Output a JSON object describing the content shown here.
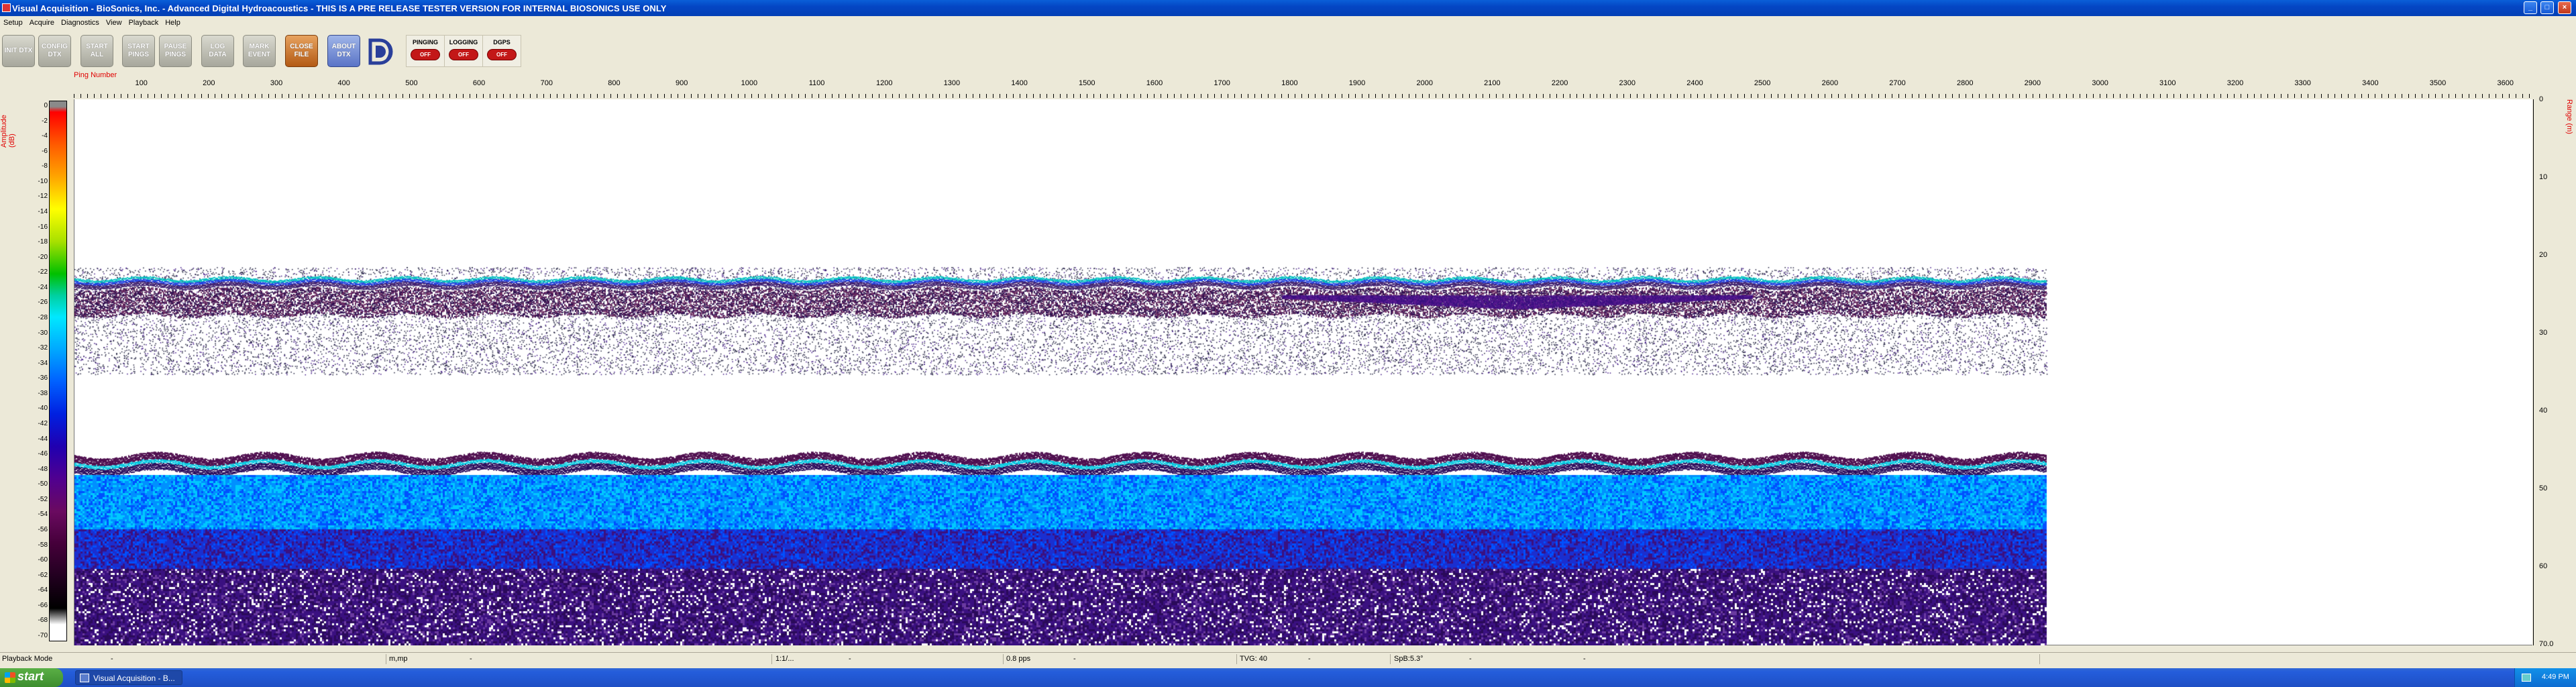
{
  "window": {
    "title": "Visual Acquisition  -  BioSonics, Inc.  -  Advanced Digital Hydroacoustics  -  THIS IS A PRE RELEASE TESTER VERSION FOR INTERNAL BIOSONICS USE ONLY",
    "minimize": "_",
    "maximize": "□",
    "close": "×"
  },
  "menu": [
    "Setup",
    "Acquire",
    "Diagnostics",
    "View",
    "Playback",
    "Help"
  ],
  "toolbar": {
    "buttons": [
      "INIT DTX",
      "CONFIG DTX",
      "START ALL",
      "START PINGS",
      "PAUSE PINGS",
      "LOG DATA",
      "MARK EVENT",
      "CLOSE FILE",
      "ABOUT DTX"
    ],
    "status": [
      {
        "label": "PINGING",
        "state": "OFF"
      },
      {
        "label": "LOGGING",
        "state": "OFF"
      },
      {
        "label": "DGPS",
        "state": "OFF"
      }
    ]
  },
  "echogram": {
    "x_axis_label": "Ping Number",
    "x_ticks": [
      "100",
      "200",
      "300",
      "400",
      "500",
      "600",
      "700",
      "800",
      "900",
      "1000",
      "1100",
      "1200",
      "1300",
      "1400",
      "1500",
      "1600",
      "1700",
      "1800",
      "1900",
      "2000",
      "2100",
      "2200",
      "2300",
      "2400",
      "2500",
      "2600",
      "2700",
      "2800",
      "2900",
      "3000",
      "3100",
      "3200",
      "3300",
      "3400",
      "3500",
      "3600"
    ],
    "amplitude_label": "Amplitude (dB)",
    "amplitude_ticks": [
      "0",
      "-2",
      "-4",
      "-6",
      "-8",
      "-10",
      "-12",
      "-14",
      "-16",
      "-18",
      "-20",
      "-22",
      "-24",
      "-26",
      "-28",
      "-30",
      "-32",
      "-34",
      "-36",
      "-38",
      "-40",
      "-42",
      "-44",
      "-46",
      "-48",
      "-50",
      "-52",
      "-54",
      "-56",
      "-58",
      "-60",
      "-62",
      "-64",
      "-66",
      "-68",
      "-70"
    ],
    "range_label": "Range (m)",
    "range_ticks": [
      "0",
      "10",
      "20",
      "30",
      "40",
      "50",
      "60",
      "70.0"
    ],
    "data_ping_extent": 2920
  },
  "statusbar": {
    "mode": "Playback Mode",
    "dash1": "-",
    "units": "m,mp",
    "dash2": "-",
    "field3": "1:1/...",
    "dash3": "-",
    "rate": "0.8 pps",
    "dash4": "-",
    "tvg": "TVG: 40",
    "dash5": "-",
    "sp": "SpB:5.3°",
    "dash6": "-",
    "dash7": "-"
  },
  "taskbar": {
    "start": "start",
    "task": "Visual Acquisition - B...",
    "clock": "4:49 PM"
  }
}
